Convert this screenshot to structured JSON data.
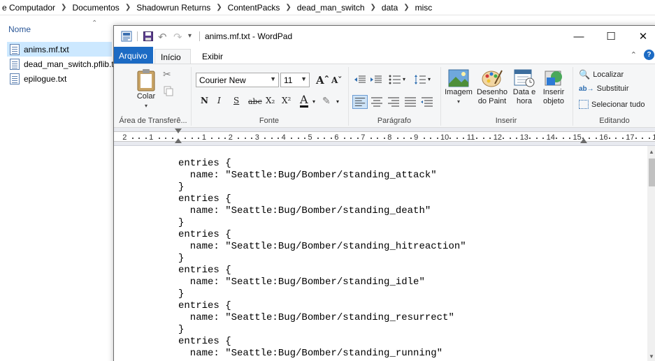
{
  "explorer": {
    "breadcrumb": [
      "e Computador",
      "Documentos",
      "Shadowrun Returns",
      "ContentPacks",
      "dead_man_switch",
      "data",
      "misc"
    ],
    "column_header": "Nome",
    "files": [
      {
        "name": "anims.mf.txt",
        "selected": true
      },
      {
        "name": "dead_man_switch.pflib.t"
      },
      {
        "name": "epilogue.txt"
      }
    ]
  },
  "wordpad": {
    "title": "anims.mf.txt - WordPad",
    "tabs": {
      "file": "Arquivo",
      "home": "Início",
      "view": "Exibir"
    },
    "clipboard": {
      "paste": "Colar",
      "group": "Área de Transferê..."
    },
    "font": {
      "name": "Courier New",
      "size": "11",
      "group": "Fonte",
      "bold": "N",
      "italic": "I",
      "underline": "S",
      "strike": "abc",
      "sub": "X₂",
      "sup": "X²"
    },
    "paragraph": {
      "group": "Parágrafo"
    },
    "insert": {
      "image": "Imagem",
      "paint_line1": "Desenho",
      "paint_line2": "do Paint",
      "date_line1": "Data e",
      "date_line2": "hora",
      "object_line1": "Inserir",
      "object_line2": "objeto",
      "group": "Inserir"
    },
    "editing": {
      "find": "Localizar",
      "replace": "Substituir",
      "select_all": "Selecionar tudo",
      "group": "Editando"
    },
    "ruler": [
      "2",
      "1",
      "1",
      "2",
      "3",
      "4",
      "5",
      "6",
      "7",
      "8",
      "9",
      "10",
      "11",
      "12",
      "13",
      "14",
      "15",
      "16",
      "17",
      "1"
    ],
    "document_lines": [
      "entries {",
      "  name: \"Seattle:Bug/Bomber/standing_attack\"",
      "}",
      "entries {",
      "  name: \"Seattle:Bug/Bomber/standing_death\"",
      "}",
      "entries {",
      "  name: \"Seattle:Bug/Bomber/standing_hitreaction\"",
      "}",
      "entries {",
      "  name: \"Seattle:Bug/Bomber/standing_idle\"",
      "}",
      "entries {",
      "  name: \"Seattle:Bug/Bomber/standing_resurrect\"",
      "}",
      "entries {",
      "  name: \"Seattle:Bug/Bomber/standing_running\""
    ]
  },
  "colors": {
    "accent": "#1c6bc4",
    "selection": "#cce8ff",
    "ribbon": "#f5f6f7"
  }
}
